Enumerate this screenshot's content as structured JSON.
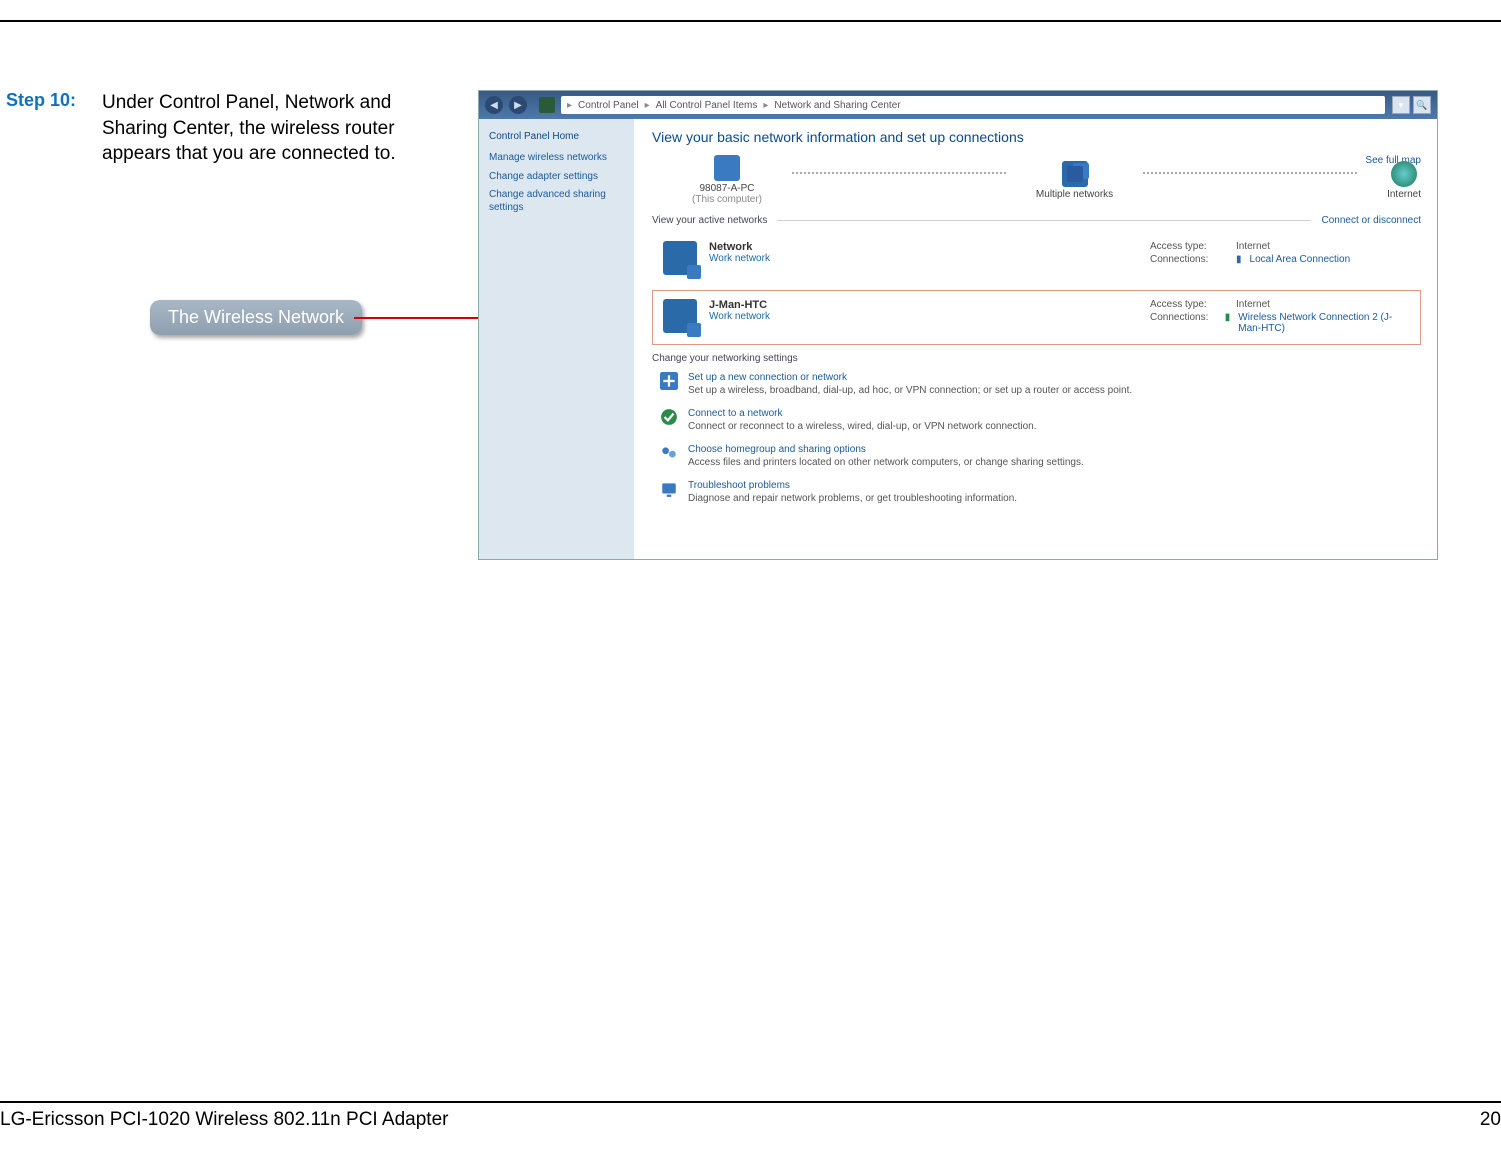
{
  "step_label": "Step 10:",
  "step_text": "Under Control Panel, Network and Sharing Center, the wireless router appears that you are connected to.",
  "annotation": "The Wireless Network",
  "footer_left": "LG-Ericsson PCI-1020 Wireless 802.11n PCI Adapter",
  "footer_right": "20",
  "win": {
    "breadcrumb": [
      "Control Panel",
      "All Control Panel Items",
      "Network and Sharing Center"
    ],
    "sidebar": {
      "home": "Control Panel Home",
      "links": [
        "Manage wireless networks",
        "Change adapter settings",
        "Change advanced sharing settings"
      ]
    },
    "heading": "View your basic network information and set up connections",
    "full_map": "See full map",
    "nodes": {
      "pc": "98087-A-PC",
      "pc_sub": "(This computer)",
      "multi": "Multiple networks",
      "internet": "Internet"
    },
    "active_heading": "View your active networks",
    "connect_link": "Connect or disconnect",
    "net1": {
      "name": "Network",
      "type": "Work network",
      "access_label": "Access type:",
      "access": "Internet",
      "conn_label": "Connections:",
      "conn": "Local Area Connection"
    },
    "net2": {
      "name": "J-Man-HTC",
      "type": "Work network",
      "access_label": "Access type:",
      "access": "Internet",
      "conn_label": "Connections:",
      "conn": "Wireless Network Connection 2 (J-Man-HTC)"
    },
    "settings_heading": "Change your networking settings",
    "items": [
      {
        "title": "Set up a new connection or network",
        "desc": "Set up a wireless, broadband, dial-up, ad hoc, or VPN connection; or set up a router or access point."
      },
      {
        "title": "Connect to a network",
        "desc": "Connect or reconnect to a wireless, wired, dial-up, or VPN network connection."
      },
      {
        "title": "Choose homegroup and sharing options",
        "desc": "Access files and printers located on other network computers, or change sharing settings."
      },
      {
        "title": "Troubleshoot problems",
        "desc": "Diagnose and repair network problems, or get troubleshooting information."
      }
    ]
  }
}
